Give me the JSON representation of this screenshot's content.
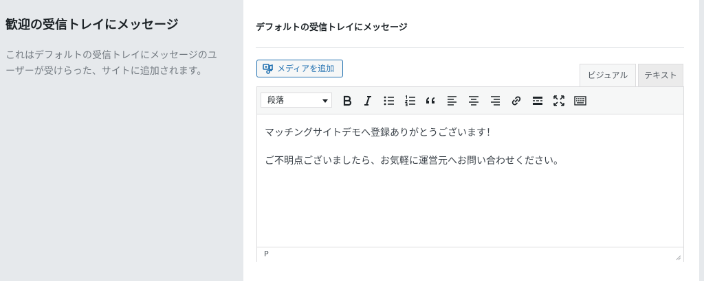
{
  "sidebar": {
    "title": "歓迎の受信トレイにメッセージ",
    "description": "これはデフォルトの受信トレイにメッセージのユーザーが受けらった、サイトに追加されます。"
  },
  "section": {
    "title": "デフォルトの受信トレイにメッセージ"
  },
  "media_button": {
    "label": "メディアを追加",
    "icon": "media-add-icon"
  },
  "tabs": [
    {
      "label": "ビジュアル",
      "active": true
    },
    {
      "label": "テキスト",
      "active": false
    }
  ],
  "toolbar": {
    "format_select": "段落",
    "buttons": [
      "bold",
      "italic",
      "bulleted-list",
      "numbered-list",
      "blockquote",
      "align-left",
      "align-center",
      "align-right",
      "insert-link",
      "read-more",
      "fullscreen",
      "toolbar-toggle"
    ]
  },
  "content": {
    "paragraphs": [
      "マッチングサイトデモへ登録ありがとうございます！",
      "ご不明点ございましたら、お気軽に運営元へお問い合わせください。"
    ]
  },
  "statusbar": {
    "path": "P"
  },
  "colors": {
    "accent": "#2271b1",
    "background": "#e6e9ec",
    "panel": "#ffffff"
  }
}
